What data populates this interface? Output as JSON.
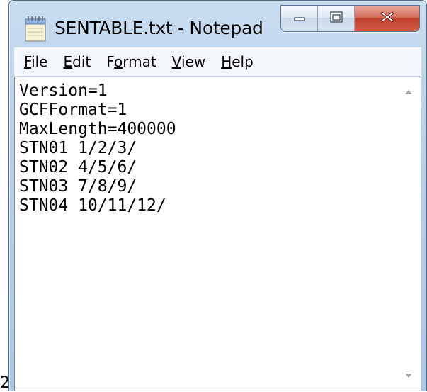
{
  "stray_text": "2",
  "window": {
    "title": "SENTABLE.txt - Notepad",
    "app_icon": "notepad-icon",
    "caption_buttons": {
      "minimize_icon": "minimize-icon",
      "maximize_icon": "maximize-icon",
      "close_icon": "close-icon"
    }
  },
  "menu": {
    "items": [
      {
        "label": "File",
        "mnemonic": "F"
      },
      {
        "label": "Edit",
        "mnemonic": "E"
      },
      {
        "label": "Format",
        "mnemonic": "o"
      },
      {
        "label": "View",
        "mnemonic": "V"
      },
      {
        "label": "Help",
        "mnemonic": "H"
      }
    ]
  },
  "editor": {
    "lines": [
      "Version=1",
      "GCFFormat=1",
      "MaxLength=400000",
      "STN01 1/2/3/",
      "STN02 4/5/6/",
      "STN03 7/8/9/",
      "STN04 10/11/12/"
    ]
  },
  "scrollbar": {
    "up_icon": "scroll-up-arrow-icon",
    "down_icon": "scroll-down-arrow-icon"
  },
  "colors": {
    "frame": "#b7cfea",
    "close_button": "#c1412c",
    "menubar": "#f3f6fb",
    "editor_bg": "#ffffff"
  }
}
